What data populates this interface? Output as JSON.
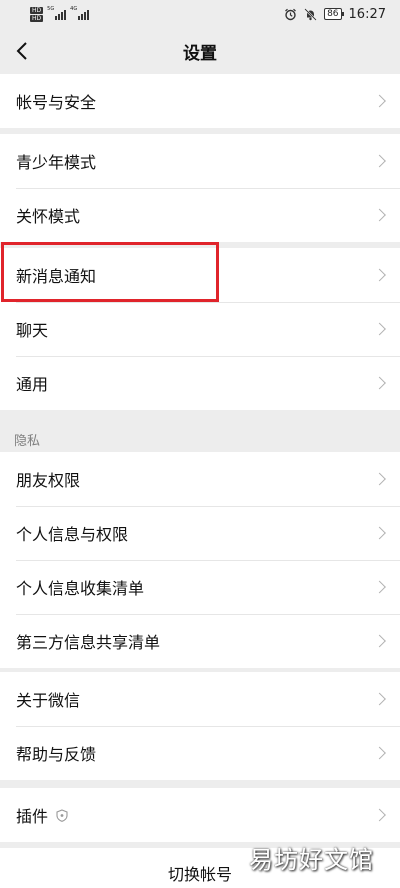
{
  "status_bar": {
    "hd1": "HD",
    "hd2": "HD",
    "net1": "5G",
    "net2": "4G",
    "battery": "86",
    "time": "16:27"
  },
  "header": {
    "title": "设置",
    "back_icon": "chevron-left-icon"
  },
  "groups": {
    "g1": {
      "items": [
        {
          "label": "帐号与安全"
        }
      ]
    },
    "g2": {
      "items": [
        {
          "label": "青少年模式"
        },
        {
          "label": "关怀模式"
        }
      ]
    },
    "g3": {
      "items": [
        {
          "label": "新消息通知"
        },
        {
          "label": "聊天"
        },
        {
          "label": "通用"
        }
      ]
    },
    "privacy": {
      "label": "隐私",
      "items": [
        {
          "label": "朋友权限"
        },
        {
          "label": "个人信息与权限"
        },
        {
          "label": "个人信息收集清单"
        },
        {
          "label": "第三方信息共享清单"
        }
      ]
    },
    "g5": {
      "items": [
        {
          "label": "关于微信"
        },
        {
          "label": "帮助与反馈"
        }
      ]
    },
    "g6": {
      "items": [
        {
          "label": "插件",
          "icon": "shield-icon"
        }
      ]
    }
  },
  "footer": {
    "switch_account": "切换帐号"
  },
  "watermark": "易坊好文馆",
  "colors": {
    "highlight": "#e0242b",
    "background": "#ededed",
    "chevron": "#b2b2b2"
  }
}
